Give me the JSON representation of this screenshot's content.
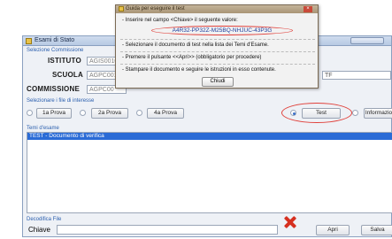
{
  "main_window": {
    "title": "Esami di Stato",
    "selection_section_label": "Selezione Commissione",
    "istituto_label": "ISTITUTO",
    "istituto_value": "AGIS0010",
    "scuola_label": "SCUOLA",
    "scuola_value": "AGPC001",
    "commissione_label": "COMMISSIONE",
    "commissione_value": "AGPC00",
    "field_tail": "TF",
    "files_section_label": "Selezionare i file di interesse",
    "prova_buttons": [
      "1a Prova",
      "2a Prova",
      "4a Prova"
    ],
    "test_button": "Test",
    "info_button": "Informazio",
    "temi_label": "Temi d'esame",
    "temi_list": [
      "TEST - Documento di verifica"
    ],
    "decode_section_label": "Decodifica File",
    "chiave_label": "Chiave",
    "apri_button": "Apri",
    "salva_button": "Salva"
  },
  "popup": {
    "title": "Guida per eseguire il test",
    "line1": "- Inserire nel campo <Chiave> il seguente valore:",
    "code": "A4R32-PP32Z-M25BQ-NHJUC-43P3G",
    "line2": "- Selezionare il documento di test nella lista dei Temi d'Esame.",
    "line3": "- Premere il pulsante <<Apri>>  (obbligatorio per procedere)",
    "line4": "- Stampare il documento e seguire le istruzioni in esso contenute.",
    "close_button": "Chiudi"
  },
  "colors": {
    "accent_blue": "#2a6bd6",
    "highlight_red": "#e0403a",
    "label_blue": "#2b5fae"
  }
}
